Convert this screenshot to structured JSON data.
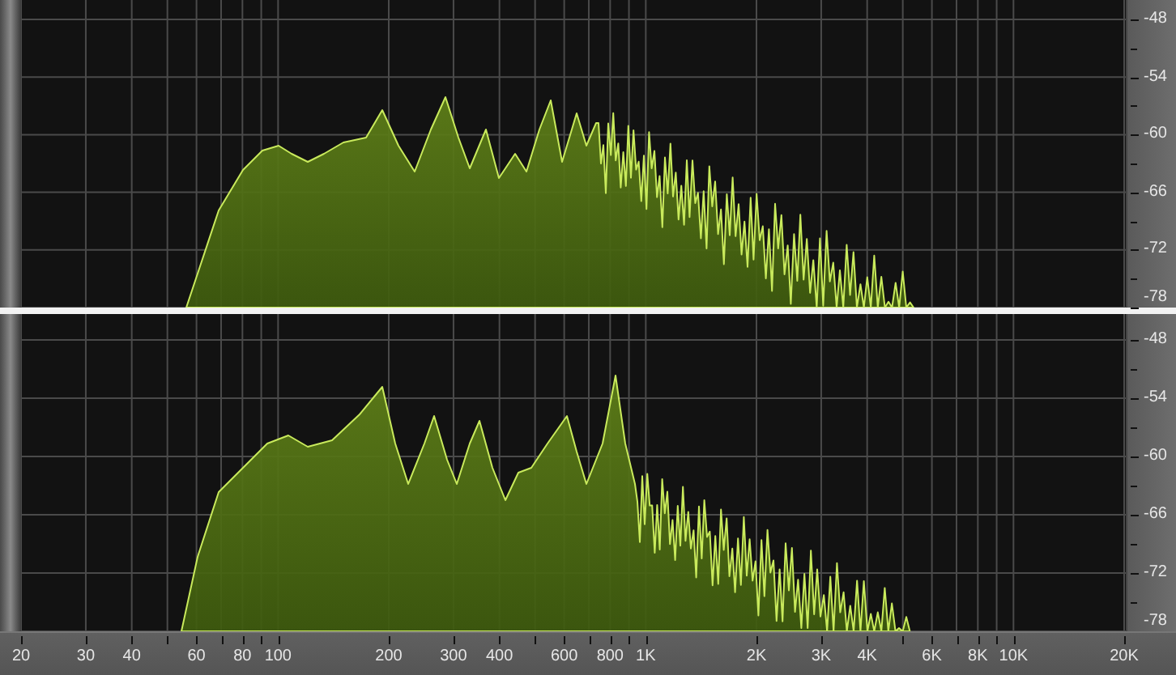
{
  "panels": [
    {
      "db_scale": [
        "-48",
        "-54",
        "-60",
        "-66",
        "-72",
        "-78"
      ]
    },
    {
      "db_scale": [
        "-48",
        "-54",
        "-60",
        "-66",
        "-72",
        "-78"
      ]
    }
  ],
  "frequency_axis": [
    "20",
    "30",
    "40",
    "60",
    "80",
    "100",
    "200",
    "300",
    "400",
    "600",
    "800",
    "1K",
    "2K",
    "3K",
    "4K",
    "6K",
    "8K",
    "10K",
    "20K"
  ]
}
